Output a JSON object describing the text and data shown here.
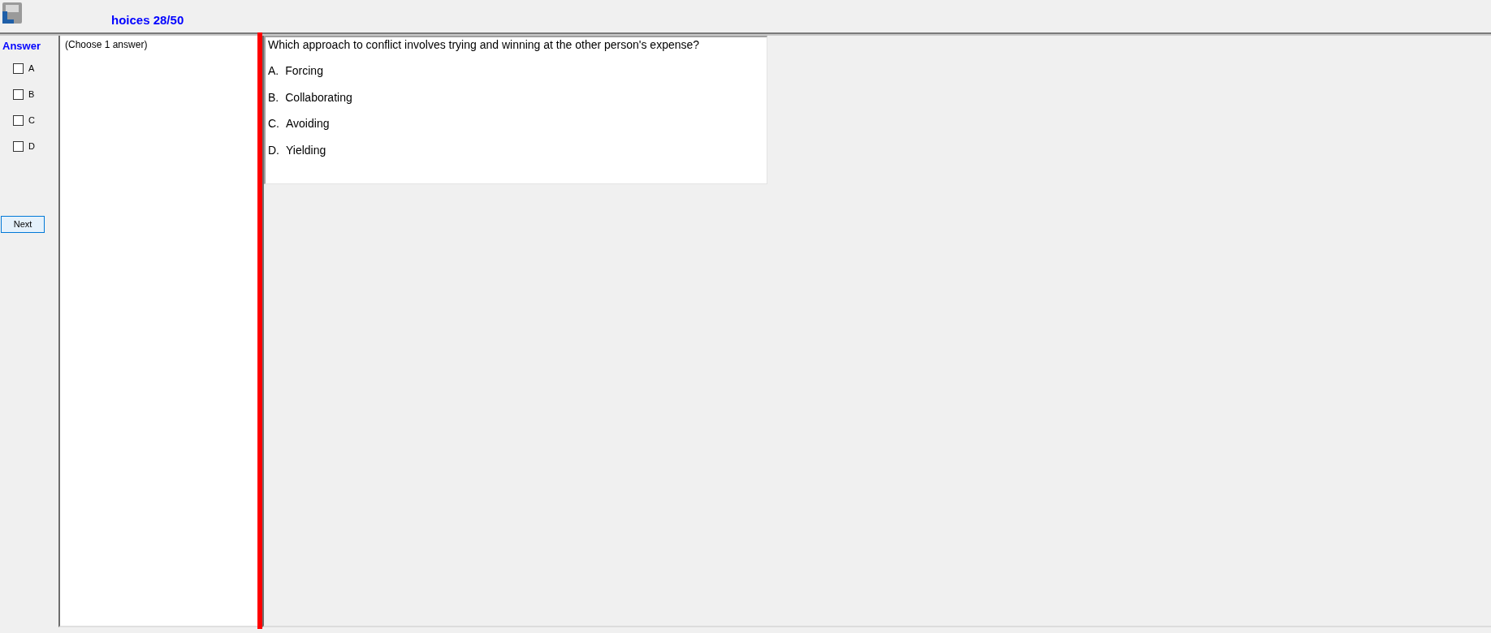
{
  "title": "hoices 28/50",
  "answer_panel": {
    "heading": "Answer",
    "options": [
      {
        "label": "A",
        "checked": false
      },
      {
        "label": "B",
        "checked": false
      },
      {
        "label": "C",
        "checked": false
      },
      {
        "label": "D",
        "checked": false
      }
    ],
    "next_button": "Next"
  },
  "instruction": "(Choose 1 answer)",
  "question": {
    "text": "Which approach to conflict involves trying and winning at the other person's expense?",
    "options": [
      {
        "letter": "A.",
        "text": "Forcing"
      },
      {
        "letter": "B.",
        "text": "Collaborating"
      },
      {
        "letter": "C.",
        "text": "Avoiding"
      },
      {
        "letter": "D.",
        "text": "Yielding"
      }
    ]
  }
}
